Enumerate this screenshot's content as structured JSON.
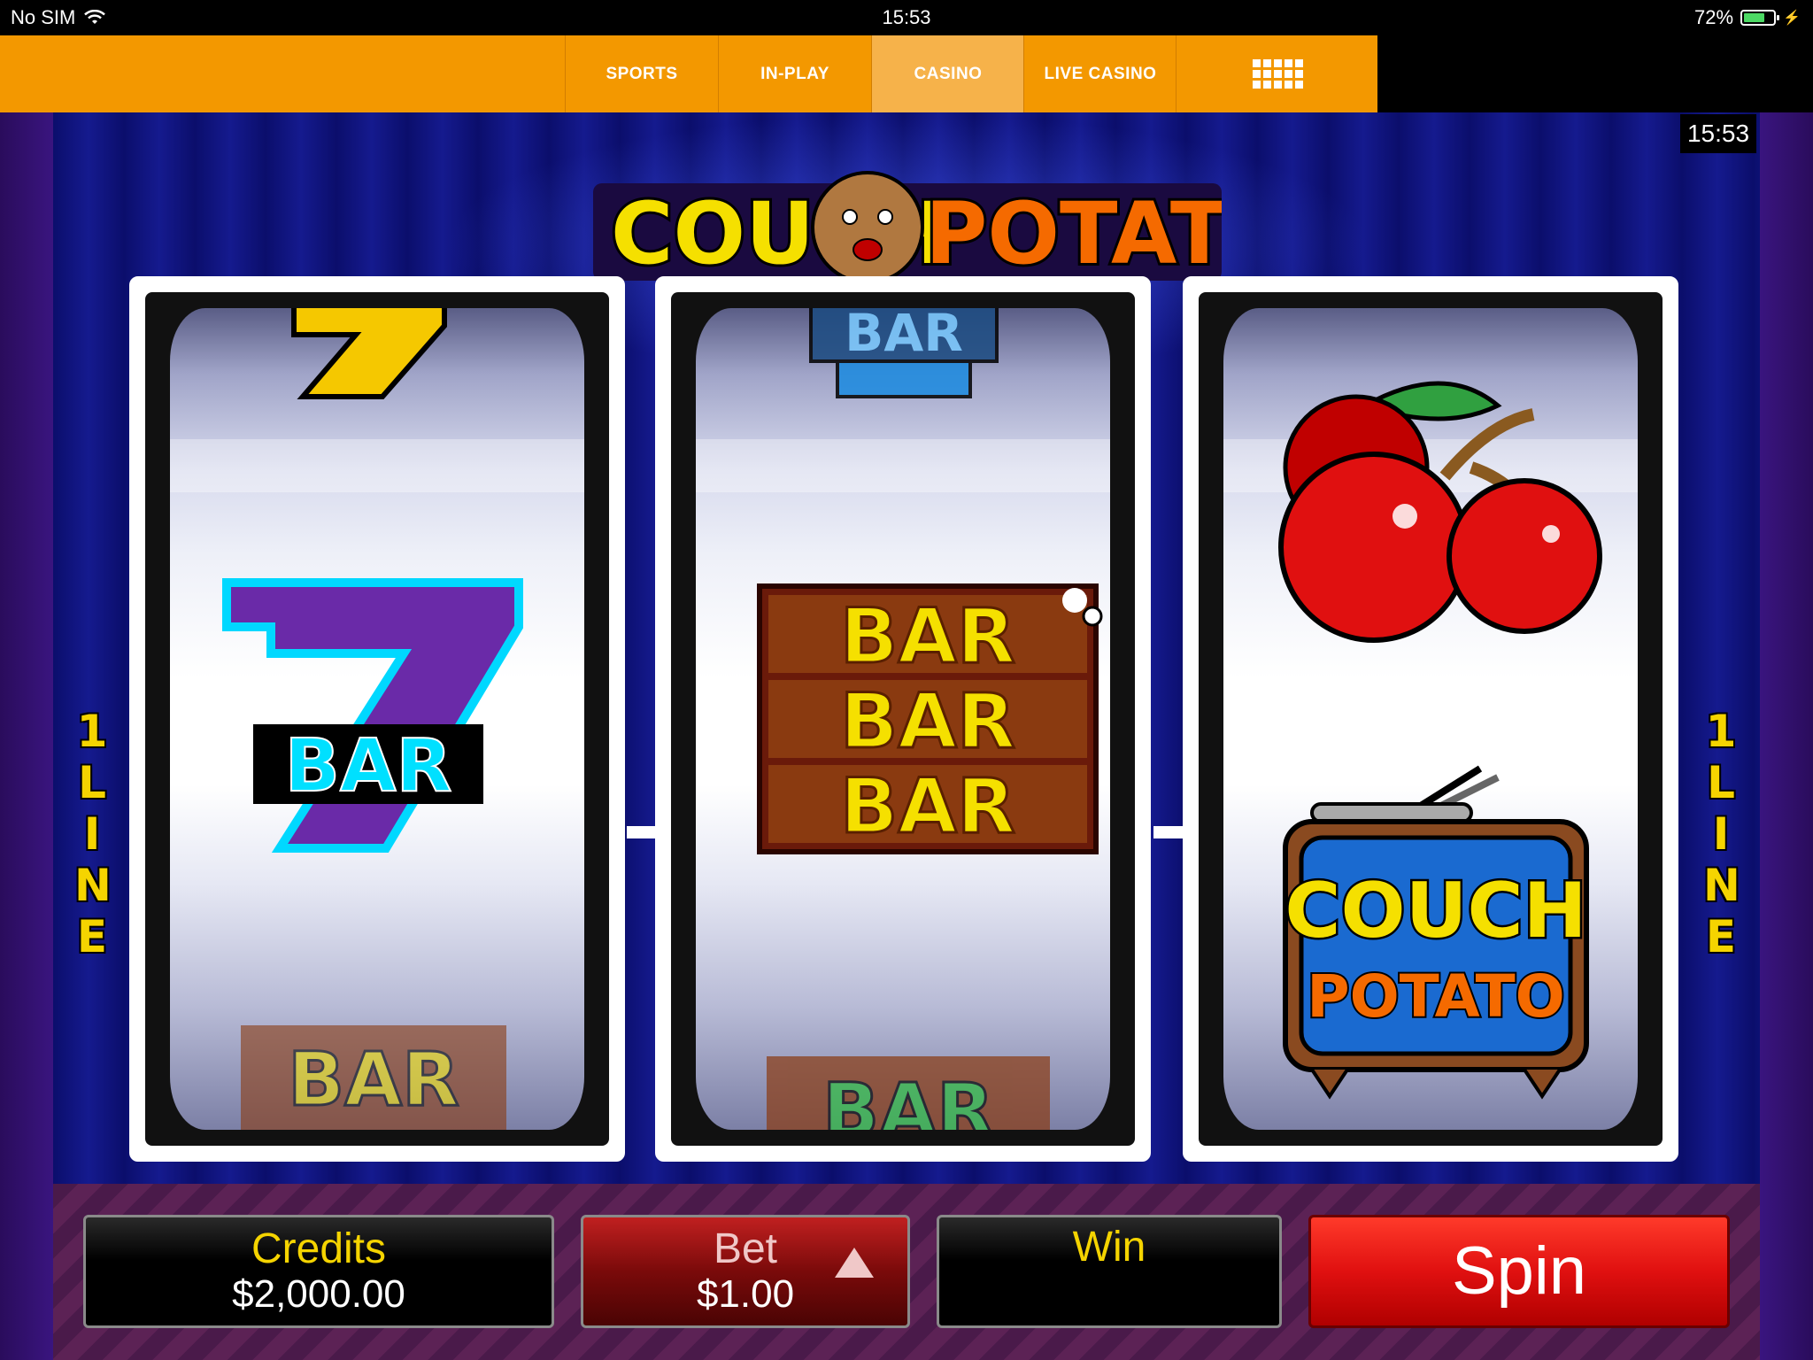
{
  "status_bar": {
    "carrier": "No SIM",
    "time": "15:53",
    "battery": "72%",
    "battery_level": 0.72
  },
  "nav": {
    "tabs": [
      {
        "label": "SPORTS",
        "active": false
      },
      {
        "label": "IN-PLAY",
        "active": false
      },
      {
        "label": "CASINO",
        "active": true
      },
      {
        "label": "LIVE CASINO",
        "active": false
      }
    ],
    "menu_icon": "grid-menu-icon"
  },
  "game": {
    "clock": "15:53",
    "logo_text_left": "COUCH",
    "logo_text_right": "POTATO",
    "line_label_left": "1 LINE",
    "line_label_right": "1 LINE",
    "reels": [
      {
        "top": "seven",
        "center": "seven-bar",
        "bottom": "double-bar"
      },
      {
        "top": "bar-blue",
        "center": "triple-bar",
        "bottom": "bar-green"
      },
      {
        "top": "cherries",
        "center": "",
        "bottom": "couch-potato-tv"
      }
    ],
    "symbols": {
      "seven_bar_text": "BAR",
      "triple_bar_text": "BAR",
      "bar_text": "BAR",
      "tv_line1": "COUCH",
      "tv_line2": "POTATO"
    }
  },
  "controls": {
    "credits_label": "Credits",
    "credits_value": "$2,000.00",
    "bet_label": "Bet",
    "bet_value": "$1.00",
    "win_label": "Win",
    "win_value": "",
    "spin_label": "Spin"
  },
  "colors": {
    "nav_orange": "#f39800",
    "nav_active": "#f6b24a",
    "label_yellow": "#f5d400",
    "spin_red": "#e01010"
  }
}
